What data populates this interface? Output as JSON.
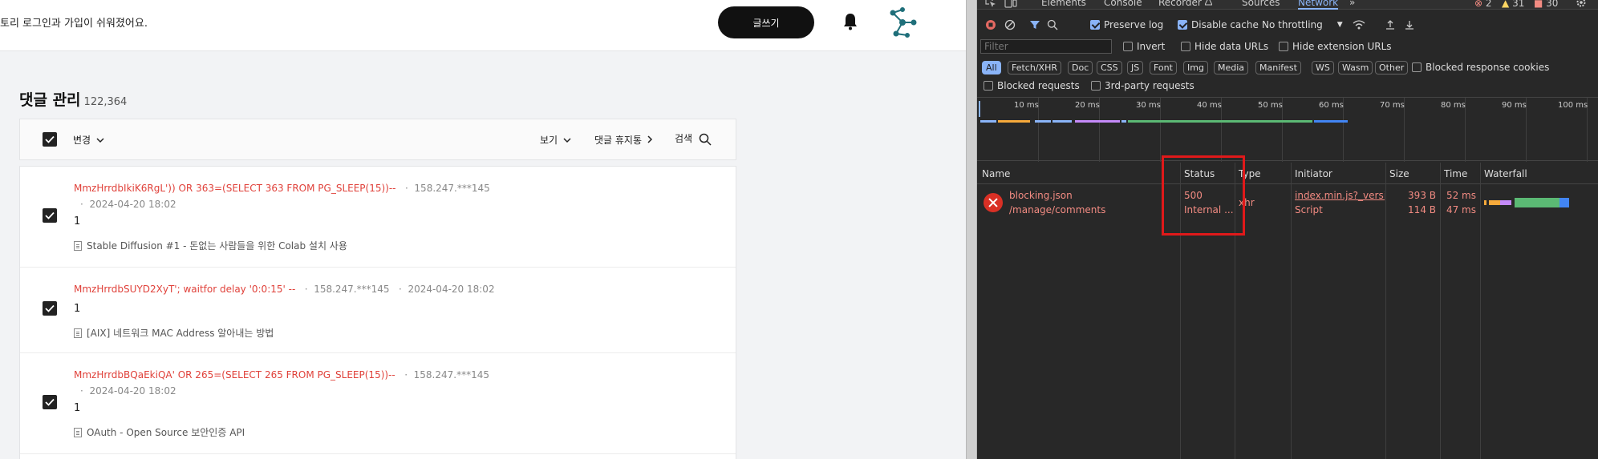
{
  "site": {
    "notice": "토리 로그인과 가입이 쉬워졌어요.",
    "write_button": "글쓰기"
  },
  "page": {
    "title": "댓글 관리",
    "count": "122,364"
  },
  "toolbar": {
    "change": "변경",
    "view": "보기",
    "trash": "댓글 휴지통",
    "search": "검색"
  },
  "comments": [
    {
      "author": "MmzHrrdbIkiK6RgL')) OR 363=(SELECT 363 FROM PG_SLEEP(15))--",
      "ip": "158.247.***145",
      "date": "2024-04-20 18:02",
      "content": "1",
      "post": "Stable Diffusion #1 - 돈없는 사람들을 위한 Colab 설치 사용"
    },
    {
      "author": "MmzHrrdbSUYD2XyT'; waitfor delay '0:0:15' --",
      "ip": "158.247.***145",
      "date": "2024-04-20 18:02",
      "content": "1",
      "post": "[AIX] 네트워크 MAC Address 알아내는 방법"
    },
    {
      "author": "MmzHrrdbBQaEkiQA' OR 265=(SELECT 265 FROM PG_SLEEP(15))--",
      "ip": "158.247.***145",
      "date": "2024-04-20 18:02",
      "content": "1",
      "post": "OAuth - Open Source 보안인증 API"
    }
  ],
  "devtools": {
    "tabs": [
      "Elements",
      "Console",
      "Recorder",
      "Sources",
      "Network"
    ],
    "active_tab": "Network",
    "errors": "2",
    "warnings": "31",
    "issues": "30",
    "preserve_log": "Preserve log",
    "disable_cache": "Disable cache",
    "throttling": "No throttling",
    "filter_placeholder": "Filter",
    "invert": "Invert",
    "hide_data_urls": "Hide data URLs",
    "hide_extension_urls": "Hide extension URLs",
    "types": [
      "All",
      "Fetch/XHR",
      "Doc",
      "CSS",
      "JS",
      "Font",
      "Img",
      "Media",
      "Manifest",
      "WS",
      "Wasm",
      "Other"
    ],
    "blocked_response_cookies": "Blocked response cookies",
    "blocked_requests": "Blocked requests",
    "third_party_requests": "3rd-party requests",
    "ticks": [
      "10 ms",
      "20 ms",
      "30 ms",
      "40 ms",
      "50 ms",
      "60 ms",
      "70 ms",
      "80 ms",
      "90 ms",
      "100 ms"
    ],
    "columns": {
      "name": "Name",
      "status": "Status",
      "type": "Type",
      "initiator": "Initiator",
      "size": "Size",
      "time": "Time",
      "waterfall": "Waterfall"
    },
    "request": {
      "name": "blocking.json",
      "path": "/manage/comments",
      "status": "500",
      "status_text": "Internal ...",
      "type": "xhr",
      "initiator": "index.min.js?_versio",
      "initiator_type": "Script",
      "size": "393 B",
      "resource_size": "114 B",
      "time": "52 ms",
      "latency": "47 ms"
    }
  }
}
